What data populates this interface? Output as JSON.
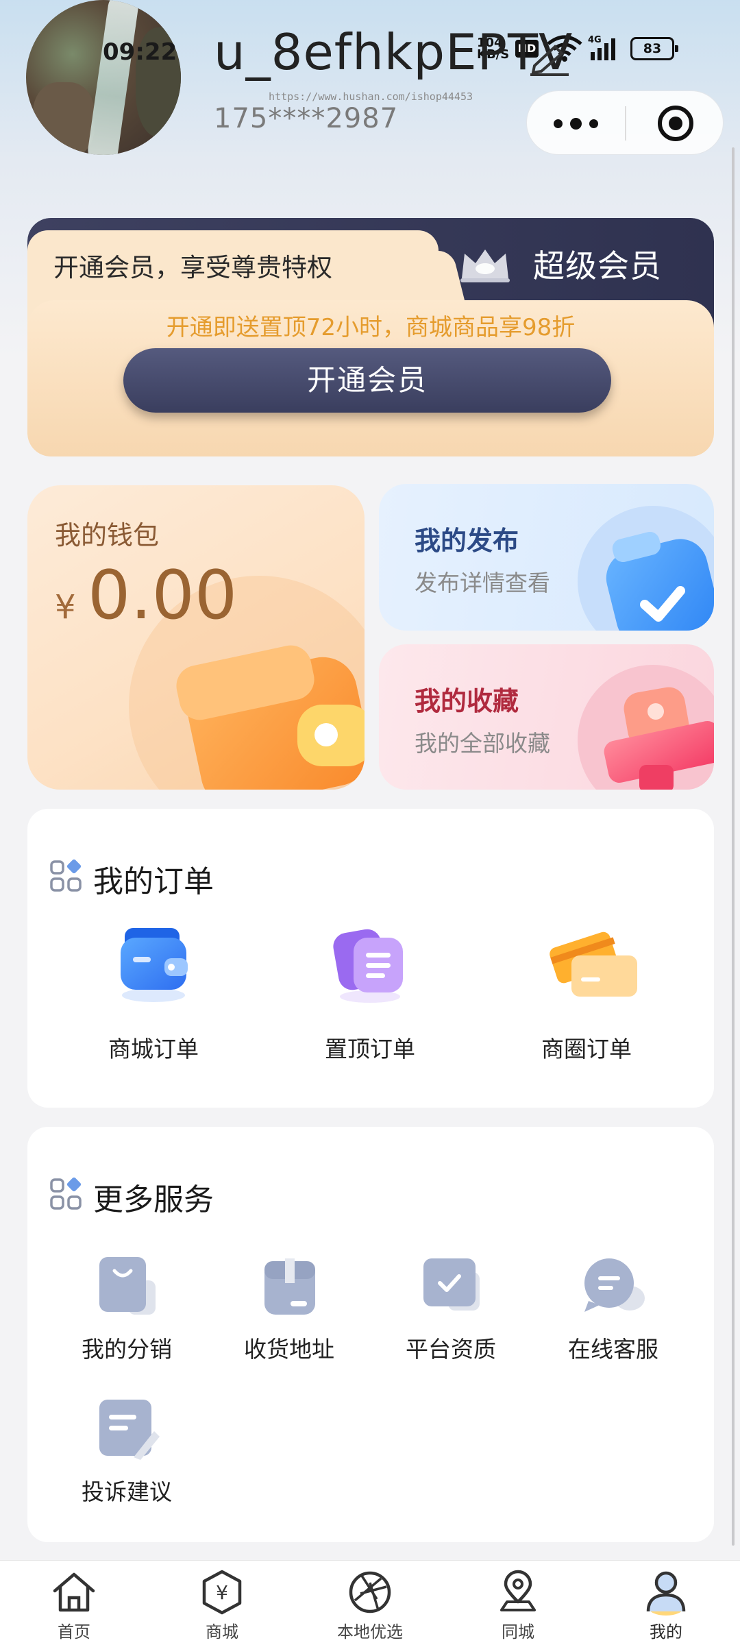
{
  "status_bar": {
    "time": "09:22",
    "speed_value": "104",
    "speed_unit": "KB/S",
    "hd": "HD",
    "network": "4G",
    "battery": "83"
  },
  "profile": {
    "username": "u_8efhkpEPTV",
    "phone": "175****2987",
    "watermark": "https://www.hushan.com/ishop44453"
  },
  "vip": {
    "tab_text": "开通会员，享受尊贵特权",
    "title": "超级会员",
    "promo": "开通即送置顶72小时，商城商品享98折",
    "button": "开通会员"
  },
  "wallet": {
    "title": "我的钱包",
    "currency": "¥",
    "balance": "0.00"
  },
  "publish": {
    "title": "我的发布",
    "subtitle": "发布详情查看"
  },
  "favorites": {
    "title": "我的收藏",
    "subtitle": "我的全部收藏"
  },
  "orders": {
    "title": "我的订单",
    "items": [
      {
        "label": "商城订单",
        "icon": "wallet-icon"
      },
      {
        "label": "置顶订单",
        "icon": "document-stack-icon"
      },
      {
        "label": "商圈订单",
        "icon": "card-icon"
      }
    ]
  },
  "services": {
    "title": "更多服务",
    "items": [
      {
        "label": "我的分销",
        "icon": "shopping-bag-icon"
      },
      {
        "label": "收货地址",
        "icon": "package-icon"
      },
      {
        "label": "平台资质",
        "icon": "certificate-icon"
      },
      {
        "label": "在线客服",
        "icon": "chat-icon"
      },
      {
        "label": "投诉建议",
        "icon": "feedback-icon"
      }
    ]
  },
  "tabbar": {
    "items": [
      {
        "label": "首页",
        "icon": "home-icon"
      },
      {
        "label": "商城",
        "icon": "yen-hexagon-icon"
      },
      {
        "label": "本地优选",
        "icon": "aperture-icon"
      },
      {
        "label": "同城",
        "icon": "location-pin-icon"
      },
      {
        "label": "我的",
        "icon": "user-icon"
      }
    ],
    "active": "我的"
  },
  "colors": {
    "vip_dark": "#3e4160",
    "vip_gold": "#e59c2e",
    "wallet_brown": "#9a6432",
    "publish_blue": "#2c4a86",
    "favorite_red": "#b02a3e"
  }
}
